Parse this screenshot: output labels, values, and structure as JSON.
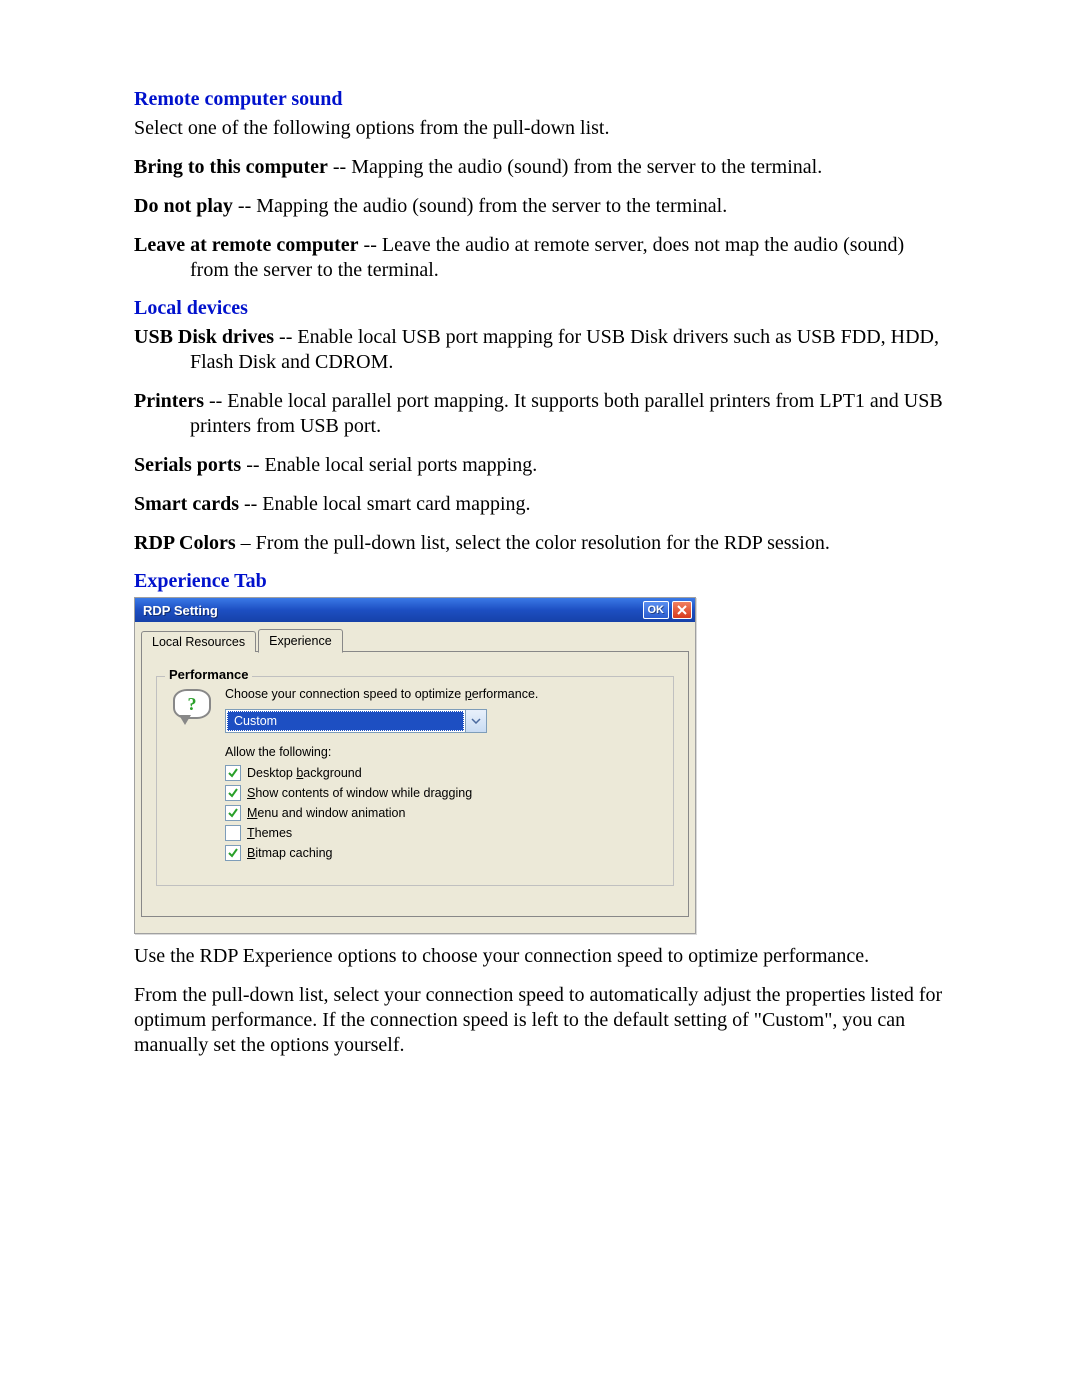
{
  "sections": {
    "remote_sound": {
      "heading": "Remote computer sound",
      "intro": "Select one of the following options from the pull-down list.",
      "items": [
        {
          "term": "Bring to this computer",
          "desc": " -- Mapping the audio (sound) from the server to the terminal."
        },
        {
          "term": "Do not play",
          "desc": " -- Mapping the audio (sound) from the server to the terminal."
        },
        {
          "term": "Leave at remote computer",
          "desc": " -- Leave the audio at remote server, does not map the audio (sound) from the server to the terminal."
        }
      ]
    },
    "local_devices": {
      "heading": "Local devices",
      "items": [
        {
          "term": "USB Disk drives",
          "desc": " -- Enable local USB port mapping for USB Disk drivers such as USB FDD, HDD, Flash Disk and CDROM."
        },
        {
          "term": "Printers",
          "desc": " -- Enable local parallel port mapping. It supports both parallel printers from LPT1 and USB printers from USB port."
        },
        {
          "term": "Serials ports",
          "desc": " -- Enable local serial ports mapping."
        },
        {
          "term": "Smart cards",
          "desc": " -- Enable local smart card mapping."
        },
        {
          "term": "RDP Colors",
          "desc": " – From the pull-down list, select the color resolution for the RDP session."
        }
      ]
    },
    "experience": {
      "heading": "Experience Tab",
      "post_dialog_1": "Use the RDP Experience options to choose your connection speed to optimize performance.",
      "post_dialog_2": "From the pull-down list, select your connection speed to automatically adjust the properties listed for optimum performance.  If the connection speed is left to the default setting of \"Custom\", you can manually set the options yourself."
    }
  },
  "dialog": {
    "title": "RDP Setting",
    "ok_label": "OK",
    "tabs": {
      "local_resources": "Local Resources",
      "experience": "Experience"
    },
    "fieldset_legend": "Performance",
    "instruction": "Choose your connection speed to optimize performance.",
    "dropdown_value": "Custom",
    "allow_label": "Allow the following:",
    "checkboxes": [
      {
        "label": "Desktop background",
        "mnemonic_index": 8,
        "checked": true
      },
      {
        "label": "Show contents of window while dragging",
        "mnemonic_index": 0,
        "checked": true
      },
      {
        "label": "Menu and window animation",
        "mnemonic_index": 0,
        "checked": true
      },
      {
        "label": "Themes",
        "mnemonic_index": 0,
        "checked": false
      },
      {
        "label": "Bitmap caching",
        "mnemonic_index": 0,
        "checked": true
      }
    ]
  }
}
